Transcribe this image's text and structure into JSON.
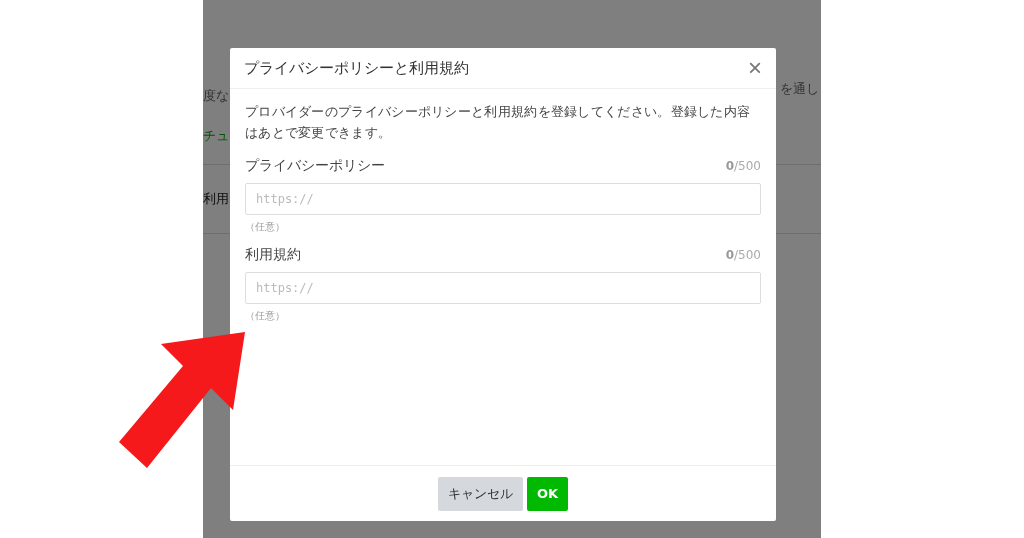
{
  "background_page": {
    "texts": [
      {
        "kind": "plain",
        "text": "度な"
      },
      {
        "kind": "link",
        "text": "チュ"
      },
      {
        "kind": "label",
        "text": "利用"
      }
    ],
    "right_text": "を通し"
  },
  "dialog": {
    "title": "プライバシーポリシーと利用規約",
    "close_icon": "×",
    "description": "プロバイダーのプライバシーポリシーと利用規約を登録してください。登録した内容はあとで変更できます。",
    "fields": [
      {
        "label": "プライバシーポリシー",
        "counter": "**0**/500",
        "placeholder": "https://",
        "hint": "（任意）"
      },
      {
        "label": "利用規約",
        "counter": "**0**/500",
        "placeholder": "https://",
        "hint": "（任意）"
      }
    ],
    "buttons": [
      {
        "kind": "secondary",
        "label": "キャンセル"
      },
      {
        "kind": "primary",
        "label": "OK"
      }
    ]
  }
}
